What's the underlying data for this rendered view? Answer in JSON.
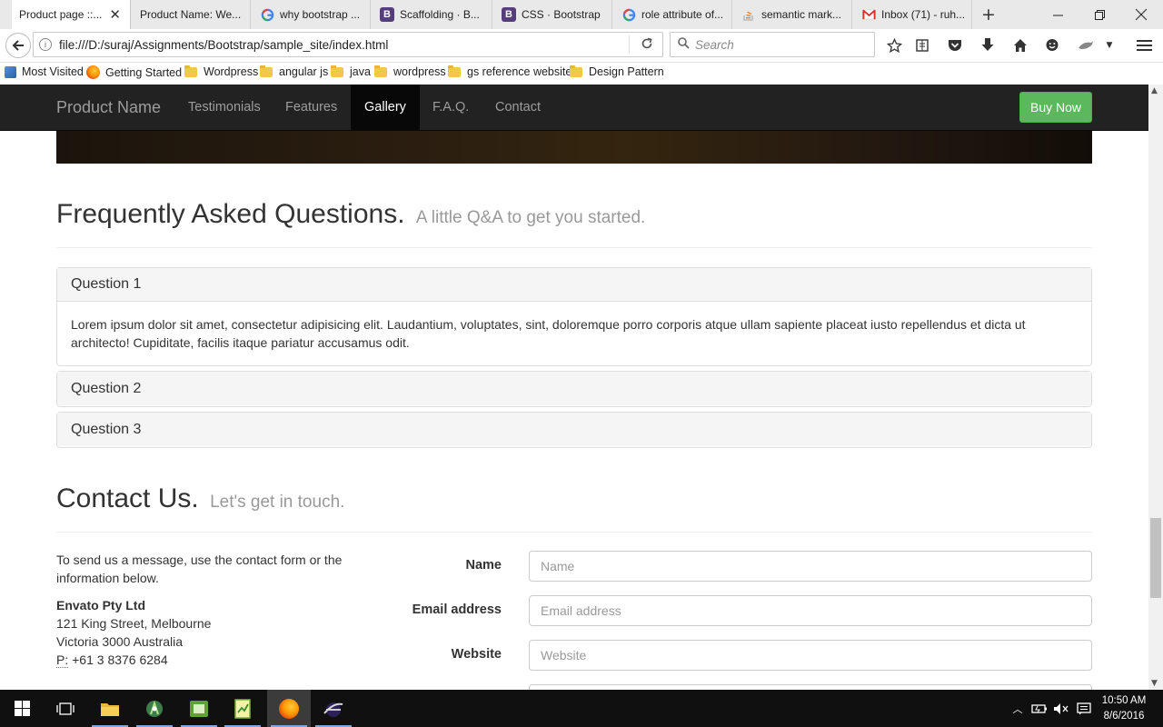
{
  "browser": {
    "tabs": [
      {
        "title": "Product page ::...",
        "icon": "page-icon",
        "active": true
      },
      {
        "title": "Product Name: We...",
        "icon": "page-icon"
      },
      {
        "title": "why bootstrap ...",
        "icon": "google-icon"
      },
      {
        "title": "Scaffolding · B...",
        "icon": "bootstrap-icon"
      },
      {
        "title": "CSS · Bootstrap",
        "icon": "bootstrap-icon"
      },
      {
        "title": "role attribute of...",
        "icon": "google-icon"
      },
      {
        "title": "semantic mark...",
        "icon": "stackoverflow-icon"
      },
      {
        "title": "Inbox (71) - ruh...",
        "icon": "gmail-icon"
      }
    ],
    "url": "file:///D:/suraj/Assignments/Bootstrap/sample_site/index.html",
    "search_placeholder": "Search",
    "bookmarks": [
      {
        "label": "Most Visited",
        "icon": "most-visited-icon"
      },
      {
        "label": "Getting Started",
        "icon": "firefox-icon"
      },
      {
        "label": "Wordpress",
        "icon": "folder-icon"
      },
      {
        "label": "angular js",
        "icon": "folder-icon"
      },
      {
        "label": "java",
        "icon": "folder-icon"
      },
      {
        "label": "wordpress",
        "icon": "folder-icon"
      },
      {
        "label": "gs reference website",
        "icon": "folder-icon"
      },
      {
        "label": "Design Pattern",
        "icon": "folder-icon"
      }
    ]
  },
  "site": {
    "brand": "Product Name",
    "nav": [
      "Testimonials",
      "Features",
      "Gallery",
      "F.A.Q.",
      "Contact"
    ],
    "active_nav": "Gallery",
    "buy_label": "Buy Now",
    "accent": "#5cb85c"
  },
  "faq": {
    "title": "Frequently Asked Questions.",
    "subtitle": "A little Q&A to get you started.",
    "items": [
      {
        "q": "Question 1",
        "a": "Lorem ipsum dolor sit amet, consectetur adipisicing elit. Laudantium, voluptates, sint, doloremque porro corporis atque ullam sapiente placeat iusto repellendus et dicta ut architecto! Cupiditate, facilis itaque pariatur accusamus odit.",
        "open": true
      },
      {
        "q": "Question 2",
        "open": false
      },
      {
        "q": "Question 3",
        "open": false
      }
    ]
  },
  "contact": {
    "title": "Contact Us.",
    "subtitle": "Let's get in touch.",
    "intro": "To send us a message, use the contact form or the information below.",
    "company": "Envato Pty Ltd",
    "address_line1": "121 King Street, Melbourne",
    "address_line2": "Victoria 3000 Australia",
    "phone_abbr": "P:",
    "phone": "+61 3 8376 6284",
    "fields": [
      {
        "label": "Name",
        "placeholder": "Name"
      },
      {
        "label": "Email address",
        "placeholder": "Email address"
      },
      {
        "label": "Website",
        "placeholder": "Website"
      }
    ]
  },
  "taskbar": {
    "time": "10:50 AM",
    "date": "8/6/2016",
    "apps": [
      "task-view-icon",
      "file-explorer-icon",
      "android-studio-icon",
      "app-icon",
      "notepad-icon",
      "firefox-icon",
      "eclipse-icon"
    ]
  }
}
